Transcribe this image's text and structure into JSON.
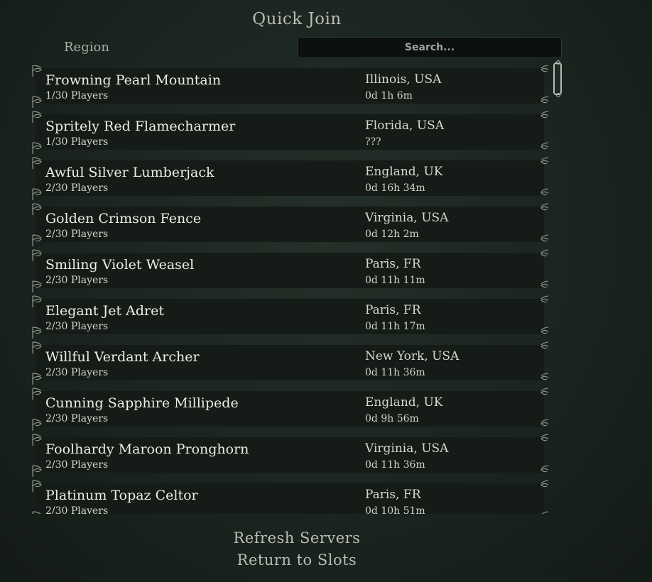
{
  "header": {
    "title": "Quick Join",
    "region_label": "Region"
  },
  "search": {
    "placeholder": "Search..."
  },
  "servers": [
    {
      "name": "Frowning Pearl Mountain",
      "players": "1/30 Players",
      "location": "Illinois, USA",
      "uptime": "0d 1h 6m"
    },
    {
      "name": "Spritely Red Flamecharmer",
      "players": "1/30 Players",
      "location": "Florida, USA",
      "uptime": "???"
    },
    {
      "name": "Awful Silver Lumberjack",
      "players": "2/30 Players",
      "location": "England, UK",
      "uptime": "0d 16h 34m"
    },
    {
      "name": "Golden Crimson Fence",
      "players": "2/30 Players",
      "location": "Virginia, USA",
      "uptime": "0d 12h 2m"
    },
    {
      "name": "Smiling Violet Weasel",
      "players": "2/30 Players",
      "location": "Paris, FR",
      "uptime": "0d 11h 11m"
    },
    {
      "name": "Elegant Jet Adret",
      "players": "2/30 Players",
      "location": "Paris, FR",
      "uptime": "0d 11h 17m"
    },
    {
      "name": "Willful Verdant Archer",
      "players": "2/30 Players",
      "location": "New York, USA",
      "uptime": "0d 11h 36m"
    },
    {
      "name": "Cunning Sapphire Millipede",
      "players": "2/30 Players",
      "location": "England, UK",
      "uptime": "0d 9h 56m"
    },
    {
      "name": "Foolhardy Maroon Pronghorn",
      "players": "2/30 Players",
      "location": "Virginia, USA",
      "uptime": "0d 11h 36m"
    },
    {
      "name": "Platinum Topaz Celtor",
      "players": "2/30 Players",
      "location": "Paris, FR",
      "uptime": "0d 10h 51m"
    }
  ],
  "footer": {
    "refresh_label": "Refresh Servers",
    "return_label": "Return to Slots"
  },
  "colors": {
    "background": "#1b2420",
    "row": "#151c18",
    "text": "#efede4",
    "muted": "#b9bdb3"
  }
}
